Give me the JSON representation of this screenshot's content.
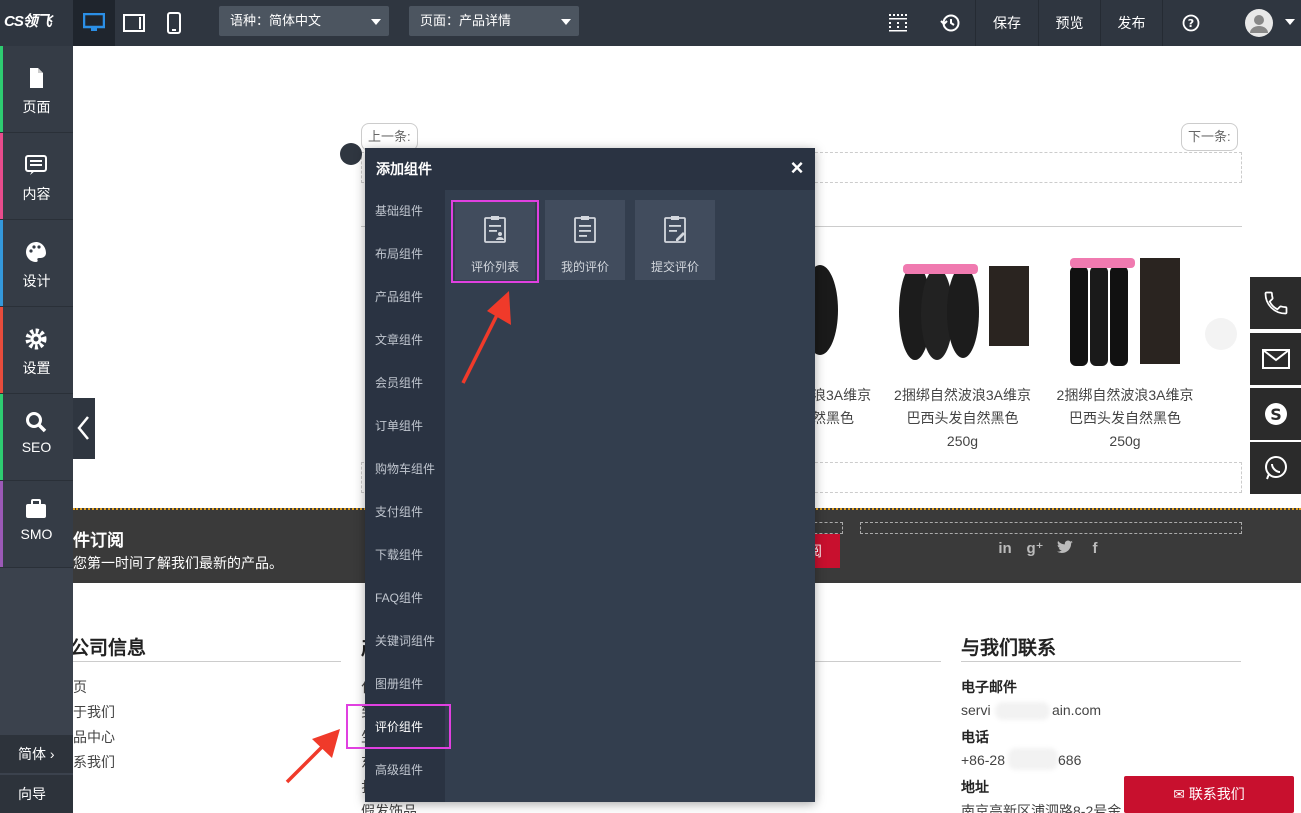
{
  "topbar": {
    "logo_text": "CS领飞",
    "language_select": "语种：简体中文",
    "page_select": "页面：产品详情",
    "save_label": "保存",
    "preview_label": "预览",
    "publish_label": "发布"
  },
  "sidebar": {
    "items": [
      {
        "label": "页面",
        "icon": "file-icon",
        "accent": "#2ecc71"
      },
      {
        "label": "内容",
        "icon": "list-icon",
        "accent": "#e74c8c"
      },
      {
        "label": "设计",
        "icon": "palette-icon",
        "accent": "#3498db"
      },
      {
        "label": "设置",
        "icon": "gear-icon",
        "accent": "#e74c3c"
      },
      {
        "label": "SEO",
        "icon": "search-icon",
        "accent": "#2ecc71"
      },
      {
        "label": "SMO",
        "icon": "briefcase-icon",
        "accent": "#9b59b6"
      }
    ],
    "language_label": "简体",
    "guide_label": "向导"
  },
  "canvas": {
    "prev_label": "上一条:",
    "next_label": "下一条:",
    "products": [
      {
        "title_line1": "浪3A维京",
        "title_line2": "然黑色"
      },
      {
        "title_line1": "2捆绑自然波浪3A维京",
        "title_line2": "巴西头发自然黑色",
        "title_line3": "250g"
      },
      {
        "title_line1": "2捆绑自然波浪3A维京",
        "title_line2": "巴西头发自然黑色",
        "title_line3": "250g"
      }
    ],
    "subscribe_title": "件订阅",
    "subscribe_text": "您第一时间了解我们最新的产品。",
    "subscribe_btn": "阅",
    "company_head": "公司信息",
    "company_links": [
      "页",
      "于我们",
      "品中心",
      "系我们"
    ],
    "col2_head": "产",
    "col2_links": [
      "化",
      "到",
      "生",
      "东",
      "扎",
      "假发饰品"
    ],
    "contact_head": "与我们联系",
    "email_label": "电子邮件",
    "email_value_a": "servi",
    "email_value_b": "ain.com",
    "phone_label": "电话",
    "phone_value_a": "+86-28",
    "phone_value_b": "686",
    "address_label": "地址",
    "address_value": "南京高新区浦泗路8-2号金"
  },
  "rail": {
    "contact_btn": "联系我们"
  },
  "modal": {
    "title": "添加组件",
    "close": "×",
    "nav": [
      "基础组件",
      "布局组件",
      "产品组件",
      "文章组件",
      "会员组件",
      "订单组件",
      "购物车组件",
      "支付组件",
      "下载组件",
      "FAQ组件",
      "关键词组件",
      "图册组件",
      "评价组件",
      "高级组件"
    ],
    "selected_nav": "评价组件",
    "tiles": [
      "评价列表",
      "我的评价",
      "提交评价"
    ],
    "highlight_color": "#e040e0",
    "arrow_color": "#f03a2a"
  }
}
